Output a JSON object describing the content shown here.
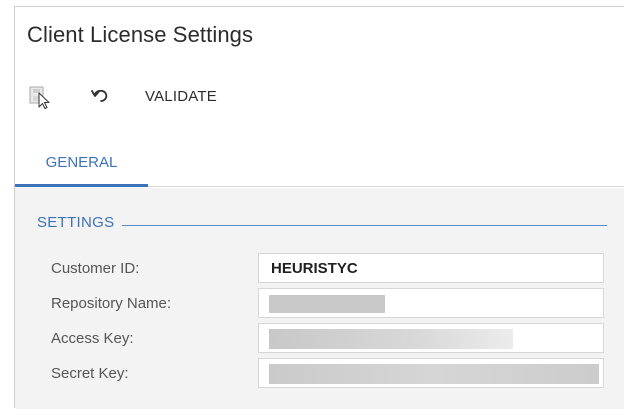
{
  "header": {
    "title": "Client License Settings"
  },
  "toolbar": {
    "save_icon": "save-icon",
    "undo_icon": "undo-icon",
    "validate_label": "VALIDATE"
  },
  "tabs": [
    {
      "label": "GENERAL",
      "active": true
    }
  ],
  "settings": {
    "section_title": "SETTINGS",
    "fields": [
      {
        "label": "Customer ID:",
        "value": "HEURISTYC"
      },
      {
        "label": "Repository Name:",
        "value": ""
      },
      {
        "label": "Access Key:",
        "value": ""
      },
      {
        "label": "Secret Key:",
        "value": ""
      }
    ]
  },
  "colors": {
    "accent": "#3d72b8",
    "panel_bg": "#f3f3f3",
    "text": "#2c2c2c"
  }
}
